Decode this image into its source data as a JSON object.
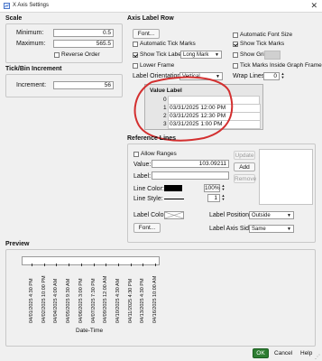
{
  "window": {
    "title": "X Axis Settings",
    "close": "✕"
  },
  "scale": {
    "title": "Scale",
    "minimum_label": "Minimum:",
    "minimum_value": "0.5",
    "maximum_label": "Maximum:",
    "maximum_value": "565.5",
    "reverse_order_label": "Reverse Order"
  },
  "tickbin": {
    "title": "Tick/Bin Increment",
    "increment_label": "Increment:",
    "increment_value": "56"
  },
  "axis_label_row": {
    "title": "Axis Label Row",
    "font_button": "Font...",
    "auto_font_size": "Automatic Font Size",
    "auto_tick_marks": "Automatic Tick Marks",
    "show_tick_marks": "Show Tick Marks",
    "show_tick_labels": "Show Tick Labels",
    "tick_label_mode": "Long Mark",
    "show_grid": "Show Grid",
    "lower_frame": "Lower Frame",
    "tick_inside": "Tick Marks Inside Graph Frame",
    "label_orientation_label": "Label Orientation",
    "label_orientation_value": "Vertical",
    "wrap_lines_label": "Wrap Lines",
    "wrap_lines_value": "0",
    "value_label_header": "Value Label",
    "rows": [
      {
        "index": "0",
        "label": ""
      },
      {
        "index": "1",
        "label": "03/31/2025 12:00 PM"
      },
      {
        "index": "2",
        "label": "03/31/2025 12:30 PM"
      },
      {
        "index": "3",
        "label": "03/31/2025 1:00 PM"
      }
    ]
  },
  "reference_lines": {
    "title": "Reference Lines",
    "allow_ranges": "Allow Ranges",
    "value_label": "Value:",
    "value": "103.09211",
    "label_label": "Label:",
    "label_value": "",
    "line_color_label": "Line Color:",
    "line_color_pct": "100%",
    "line_style_label": "Line Style:",
    "line_style_value": "1",
    "update_button": "Update",
    "add_button": "Add",
    "remove_button": "Remove",
    "label_color_label": "Label Color",
    "label_position_label": "Label Position",
    "label_position_value": "Outside",
    "font_button": "Font...",
    "label_axis_side_label": "Label Axis Side",
    "label_axis_side_value": "Same"
  },
  "preview": {
    "title": "Preview",
    "axis_title": "Date-Time",
    "tick_labels": [
      "04/01/2025 4:30 PM",
      "04/02/2025 10:00 PM",
      "04/04/2025 4:00 AM",
      "04/05/2025 9:30 AM",
      "04/06/2025 3:00 PM",
      "04/07/2025 7:30 PM",
      "04/09/2025 12:00 AM",
      "04/10/2025 4:30 AM",
      "04/11/2025 4:30 PM",
      "04/13/2025 4:30 PM",
      "04/16/2025 10:00 AM"
    ]
  },
  "footer": {
    "ok": "OK",
    "cancel": "Cancel",
    "help": "Help"
  },
  "colors": {
    "ok_accent": "#2e7d32",
    "annotation_red": "#d32f2f",
    "line_color_swatch": "#000000"
  }
}
